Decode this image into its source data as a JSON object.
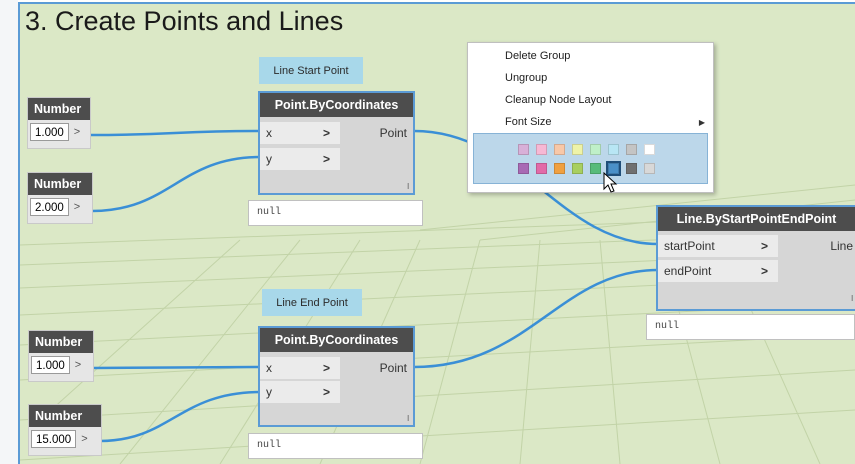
{
  "group": {
    "title": "3. Create Points and Lines"
  },
  "notes": {
    "line_start": "Line Start Point",
    "line_end": "Line End Point"
  },
  "number_nodes": [
    {
      "title": "Number",
      "value": "1.000",
      "port": ">"
    },
    {
      "title": "Number",
      "value": "2.000",
      "port": ">"
    },
    {
      "title": "Number",
      "value": "1.000",
      "port": ">"
    },
    {
      "title": "Number",
      "value": "15.000",
      "port": ">"
    }
  ],
  "point_nodes": [
    {
      "title": "Point.ByCoordinates",
      "inputs": [
        "x",
        "y"
      ],
      "output": "Point",
      "lacing": "l",
      "preview": "null"
    },
    {
      "title": "Point.ByCoordinates",
      "inputs": [
        "x",
        "y"
      ],
      "output": "Point",
      "lacing": "l",
      "preview": "null"
    }
  ],
  "line_node": {
    "title": "Line.ByStartPointEndPoint",
    "inputs": [
      "startPoint",
      "endPoint"
    ],
    "output": "Line",
    "lacing": "l",
    "preview": "null"
  },
  "port_arrow": ">",
  "context_menu": {
    "items": [
      "Delete Group",
      "Ungroup",
      "Cleanup Node Layout",
      "Font Size"
    ],
    "submenu_arrow": "▶",
    "swatches_row1": [
      "#d8b0d8",
      "#f7b8d4",
      "#f8c8a8",
      "#eef3a8",
      "#bff0c8",
      "#b8e6f4",
      "#c4c4c4",
      "#ffffff"
    ],
    "swatches_row2": [
      "#a86ab4",
      "#e26aa8",
      "#f0a040",
      "#a8cf60",
      "#58bb7a",
      "#4a90c8",
      "#707070",
      "#d8d8d8"
    ],
    "selected_swatch": "#4a90c8"
  },
  "colors": {
    "group_background": "#dbe8c6",
    "group_border": "#5b9bd5",
    "note": "#a8d8ea",
    "node_header": "#4d4d4d",
    "wire": "#3a8fd6"
  }
}
